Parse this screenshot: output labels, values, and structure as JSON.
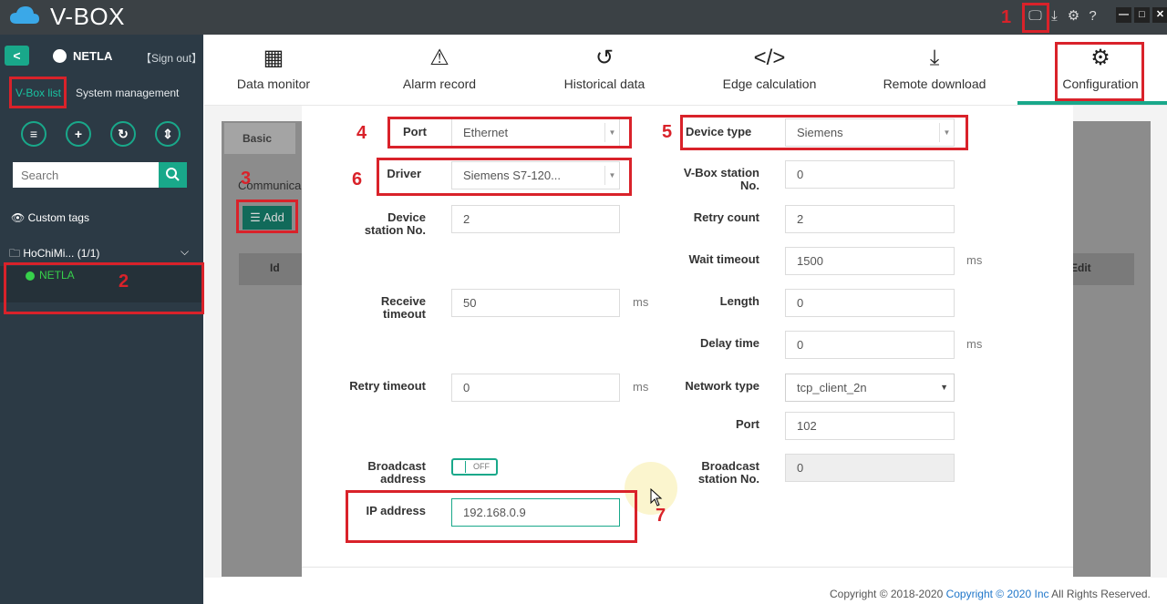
{
  "app": {
    "title": "V-BOX"
  },
  "window_controls": {
    "minimize": "—",
    "maximize": "□",
    "close": "✕"
  },
  "header_icons": [
    "monitor-icon",
    "download-icon",
    "gear-icon",
    "help-icon"
  ],
  "sidebar": {
    "back": "<",
    "user": "NETLA",
    "sign_out": "【Sign out】",
    "tabs": {
      "vbox_list": "V-Box list",
      "system_management": "System management"
    },
    "search_placeholder": "Search",
    "custom_tags": "Custom tags",
    "group": "HoChiMi...  (1/1)",
    "device": "NETLA"
  },
  "nav": {
    "data_monitor": "Data monitor",
    "alarm_record": "Alarm record",
    "historical_data": "Historical data",
    "edge_calculation": "Edge calculation",
    "remote_download": "Remote download",
    "configuration": "Configuration"
  },
  "background": {
    "basic_tab": "Basic",
    "communication": "Communica",
    "add": "Add",
    "col_id": "Id",
    "col_edit": "Edit"
  },
  "form": {
    "port": {
      "label": "Port",
      "value": "Ethernet"
    },
    "device_type": {
      "label": "Device type",
      "value": "Siemens"
    },
    "driver": {
      "label": "Driver",
      "value": "Siemens S7-120..."
    },
    "vbox_station": {
      "label_l1": "V-Box station",
      "label_l2": "No.",
      "value": "0"
    },
    "device_station": {
      "label_l1": "Device",
      "label_l2": "station No.",
      "value": "2"
    },
    "retry_count": {
      "label": "Retry count",
      "value": "2"
    },
    "wait_timeout": {
      "label": "Wait timeout",
      "value": "1500",
      "unit": "ms"
    },
    "receive_timeout": {
      "label_l1": "Receive",
      "label_l2": "timeout",
      "value": "50",
      "unit": "ms"
    },
    "length": {
      "label": "Length",
      "value": "0"
    },
    "delay_time": {
      "label": "Delay time",
      "value": "0",
      "unit": "ms"
    },
    "retry_timeout": {
      "label": "Retry timeout",
      "value": "0",
      "unit": "ms"
    },
    "network_type": {
      "label": "Network type",
      "value": "tcp_client_2n"
    },
    "port_number": {
      "label": "Port",
      "value": "102"
    },
    "broadcast_address": {
      "label_l1": "Broadcast",
      "label_l2": "address",
      "toggle": "OFF"
    },
    "broadcast_station": {
      "label_l1": "Broadcast",
      "label_l2": "station No.",
      "value": "0"
    },
    "ip_address": {
      "label": "IP address",
      "value": "192.168.0.9"
    }
  },
  "annotations": [
    "1",
    "2",
    "3",
    "4",
    "5",
    "6",
    "7"
  ],
  "footer": {
    "prefix": "Copyright © 2018-2020 ",
    "link": "Copyright © 2020 Inc",
    "suffix": " All Rights Reserved."
  },
  "colors": {
    "accent": "#19a88a",
    "annotation": "#d9222a",
    "sidebar": "#2c3a45",
    "titlebar": "#3b4145"
  }
}
